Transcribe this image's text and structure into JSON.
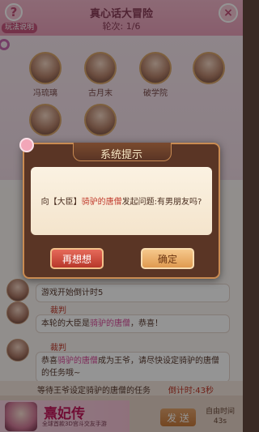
{
  "header": {
    "title": "真心话大冒险",
    "round": "轮次: 1/6",
    "help_label": "玩法说明",
    "help_icon": "?",
    "close_icon": "×"
  },
  "players": [
    {
      "name": "冯琉璃"
    },
    {
      "name": "古月末"
    },
    {
      "name": "破学院"
    },
    {
      "name": ""
    },
    {
      "name": ""
    },
    {
      "name": ""
    }
  ],
  "chat": {
    "messages": [
      {
        "text": "游戏开始倒计时5"
      },
      {
        "name": "裁判",
        "text_a": "本轮的大臣是",
        "highlight": "骑驴的唐僧",
        "text_b": "，恭喜！"
      },
      {
        "name": "裁判",
        "text_a": "恭喜",
        "highlight2": "骑驴的唐僧",
        "text_b2": "成为王爷，请尽快设定骑驴的唐僧的任务哦~"
      }
    ],
    "task": "等待王爷设定骑驴的唐僧的任务",
    "countdown": "倒计时:43秒"
  },
  "bottom": {
    "send": "发 送",
    "free_time_label": "自由时间",
    "free_time_value": "43s"
  },
  "ad": {
    "title": "熹妃传",
    "subtitle": "全球首款3D宫斗交友手游"
  },
  "dialog": {
    "title": "系统提示",
    "message_prefix": "向【大臣】",
    "message_name": "骑驴的唐僧",
    "message_suffix": "发起问题:有男朋友吗?",
    "cancel": "再想想",
    "confirm": "确定"
  },
  "colors": {
    "accent": "#c0392b",
    "highlight": "#d84b9a",
    "dialog_bg": "#5a3525"
  }
}
